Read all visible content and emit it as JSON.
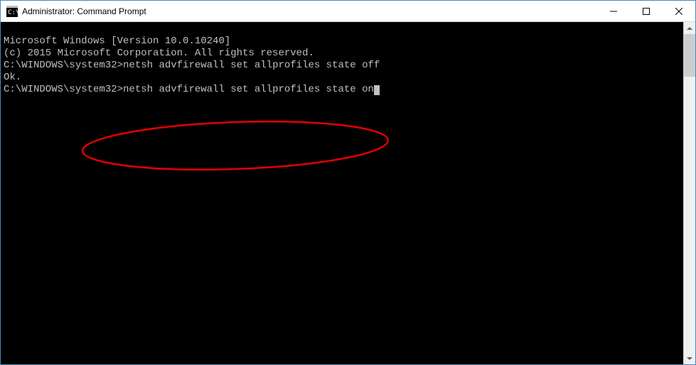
{
  "title": "Administrator: Command Prompt",
  "terminal": {
    "line1": "Microsoft Windows [Version 10.0.10240]",
    "line2": "(c) 2015 Microsoft Corporation. All rights reserved.",
    "blank1": "",
    "prompt1": "C:\\WINDOWS\\system32>",
    "cmd1": "netsh advfirewall set allprofiles state off",
    "result1": "Ok.",
    "blank2": "",
    "blank3": "",
    "prompt2": "C:\\WINDOWS\\system32>",
    "cmd2": "netsh advfirewall set allprofiles state on"
  },
  "annotation": {
    "color": "#e60000"
  }
}
